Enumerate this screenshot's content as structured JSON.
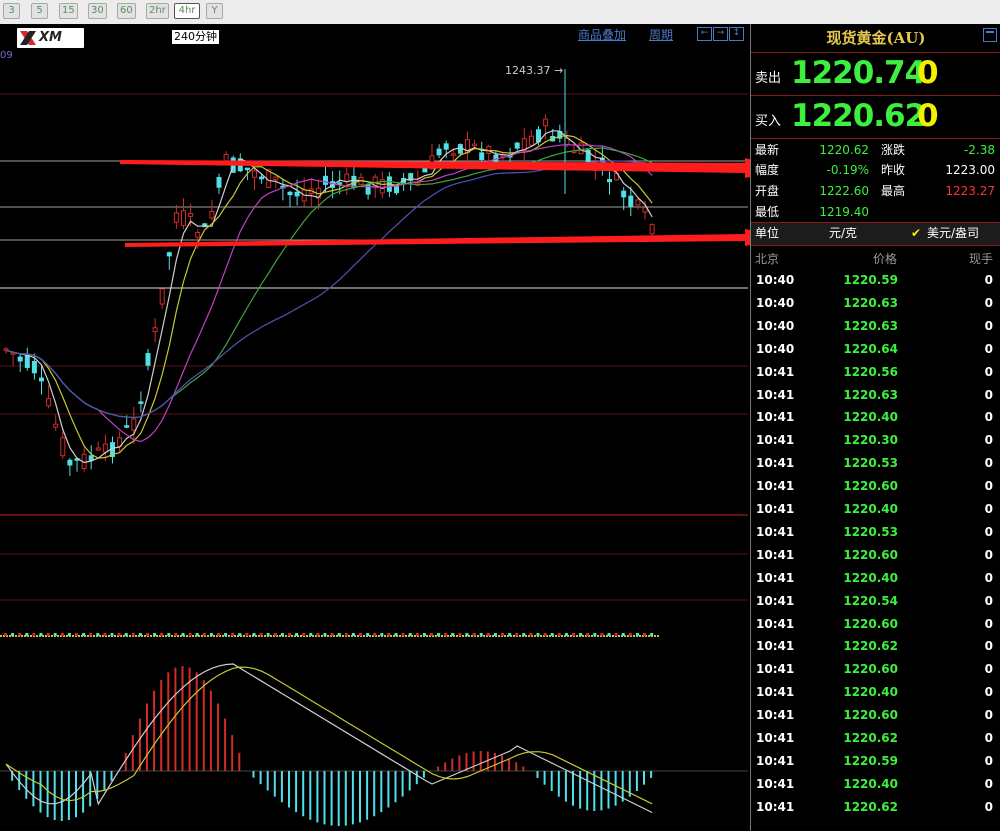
{
  "toolbar": {
    "buttons": [
      "3",
      "5",
      "15",
      "30",
      "60",
      "2hr",
      "4hr",
      "Y"
    ],
    "active_index": 6
  },
  "chart": {
    "period_label": "240分钟",
    "overlay_link": "商品叠加",
    "period_link": "周期",
    "edge_label": "09",
    "peak_label": "1243.37",
    "logo_text": "XM",
    "colors": {
      "up": "#4fe0e8",
      "down": "#d12b2b",
      "ma5": "#cfcfcf",
      "ma10": "#c8c832",
      "ma20": "#c040c0",
      "ma30": "#3fa63f",
      "ma60": "#5252b8",
      "arrow": "#ff1c1c"
    }
  },
  "panel": {
    "title": "现货黄金(AU)",
    "sell_label": "卖出",
    "sell_price": "1220.74",
    "sell_tail": "0",
    "buy_label": "买入",
    "buy_price": "1220.62",
    "buy_tail": "0",
    "stats": {
      "latest_label": "最新",
      "latest_value": "1220.62",
      "change_label": "涨跌",
      "change_value": "-2.38",
      "amplitude_label": "幅度",
      "amplitude_value": "-0.19%",
      "prev_close_label": "昨收",
      "prev_close_value": "1223.00",
      "open_label": "开盘",
      "open_value": "1222.60",
      "high_label": "最高",
      "high_value": "1223.27",
      "low_label": "最低",
      "low_value": "1219.40"
    },
    "unit_label": "单位",
    "unit_cny": "元/克",
    "unit_usd": "美元/盎司",
    "check_mark": "✔",
    "ticks_header": {
      "time": "北京",
      "price": "价格",
      "volume": "现手"
    },
    "ticks": [
      {
        "time": "10:40",
        "price": "1220.59",
        "vol": "0"
      },
      {
        "time": "10:40",
        "price": "1220.63",
        "vol": "0"
      },
      {
        "time": "10:40",
        "price": "1220.63",
        "vol": "0"
      },
      {
        "time": "10:40",
        "price": "1220.64",
        "vol": "0"
      },
      {
        "time": "10:41",
        "price": "1220.56",
        "vol": "0"
      },
      {
        "time": "10:41",
        "price": "1220.63",
        "vol": "0"
      },
      {
        "time": "10:41",
        "price": "1220.40",
        "vol": "0"
      },
      {
        "time": "10:41",
        "price": "1220.30",
        "vol": "0"
      },
      {
        "time": "10:41",
        "price": "1220.53",
        "vol": "0"
      },
      {
        "time": "10:41",
        "price": "1220.60",
        "vol": "0"
      },
      {
        "time": "10:41",
        "price": "1220.40",
        "vol": "0"
      },
      {
        "time": "10:41",
        "price": "1220.53",
        "vol": "0"
      },
      {
        "time": "10:41",
        "price": "1220.60",
        "vol": "0"
      },
      {
        "time": "10:41",
        "price": "1220.40",
        "vol": "0"
      },
      {
        "time": "10:41",
        "price": "1220.54",
        "vol": "0"
      },
      {
        "time": "10:41",
        "price": "1220.60",
        "vol": "0"
      },
      {
        "time": "10:41",
        "price": "1220.62",
        "vol": "0"
      },
      {
        "time": "10:41",
        "price": "1220.60",
        "vol": "0"
      },
      {
        "time": "10:41",
        "price": "1220.40",
        "vol": "0"
      },
      {
        "time": "10:41",
        "price": "1220.60",
        "vol": "0"
      },
      {
        "time": "10:41",
        "price": "1220.62",
        "vol": "0"
      },
      {
        "time": "10:41",
        "price": "1220.59",
        "vol": "0"
      },
      {
        "time": "10:41",
        "price": "1220.40",
        "vol": "0"
      },
      {
        "time": "10:41",
        "price": "1220.62",
        "vol": "0"
      }
    ]
  }
}
